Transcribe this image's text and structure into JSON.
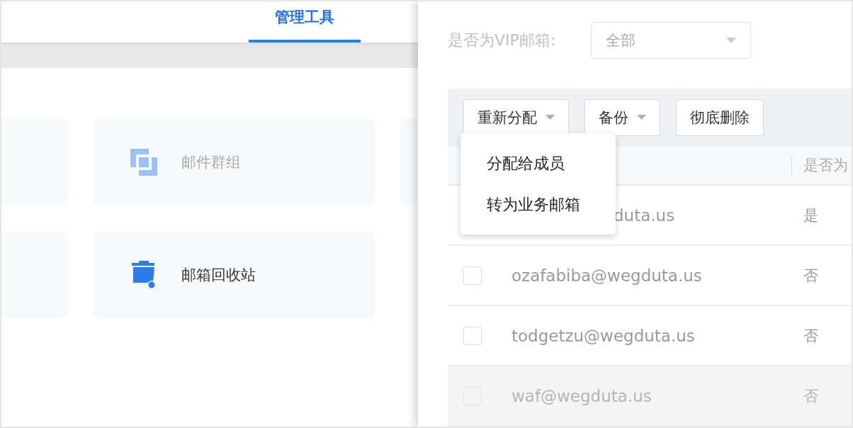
{
  "left_panel": {
    "tabs": [
      {
        "label": "管理工具",
        "selected": true
      }
    ],
    "tool_cards": [
      {
        "label": "邮件群组",
        "kind": "group",
        "disabled": true
      },
      {
        "label": "邮箱回收站",
        "kind": "trash",
        "disabled": false
      }
    ]
  },
  "right_panel": {
    "filter": {
      "label": "是否为VIP邮箱:",
      "value": "全部"
    },
    "toolbar": [
      {
        "label": "重新分配",
        "dropdown": true
      },
      {
        "label": "备份",
        "dropdown": true
      },
      {
        "label": "彻底删除",
        "dropdown": false
      }
    ],
    "dropdown_menu": [
      "分配给成员",
      "转为业务邮箱"
    ],
    "table": {
      "columns": [
        "是否为"
      ],
      "rows": [
        {
          "email": "duta.us",
          "vip": "是",
          "covered": true,
          "disabled": false
        },
        {
          "email": "ozafabiba@wegduta.us",
          "vip": "否",
          "covered": false,
          "disabled": false,
          "checked": false
        },
        {
          "email": "todgetzu@wegduta.us",
          "vip": "否",
          "covered": false,
          "disabled": false,
          "checked": false
        },
        {
          "email": "waf@wegduta.us",
          "vip": "否",
          "covered": false,
          "disabled": true,
          "checked": false
        }
      ]
    }
  }
}
